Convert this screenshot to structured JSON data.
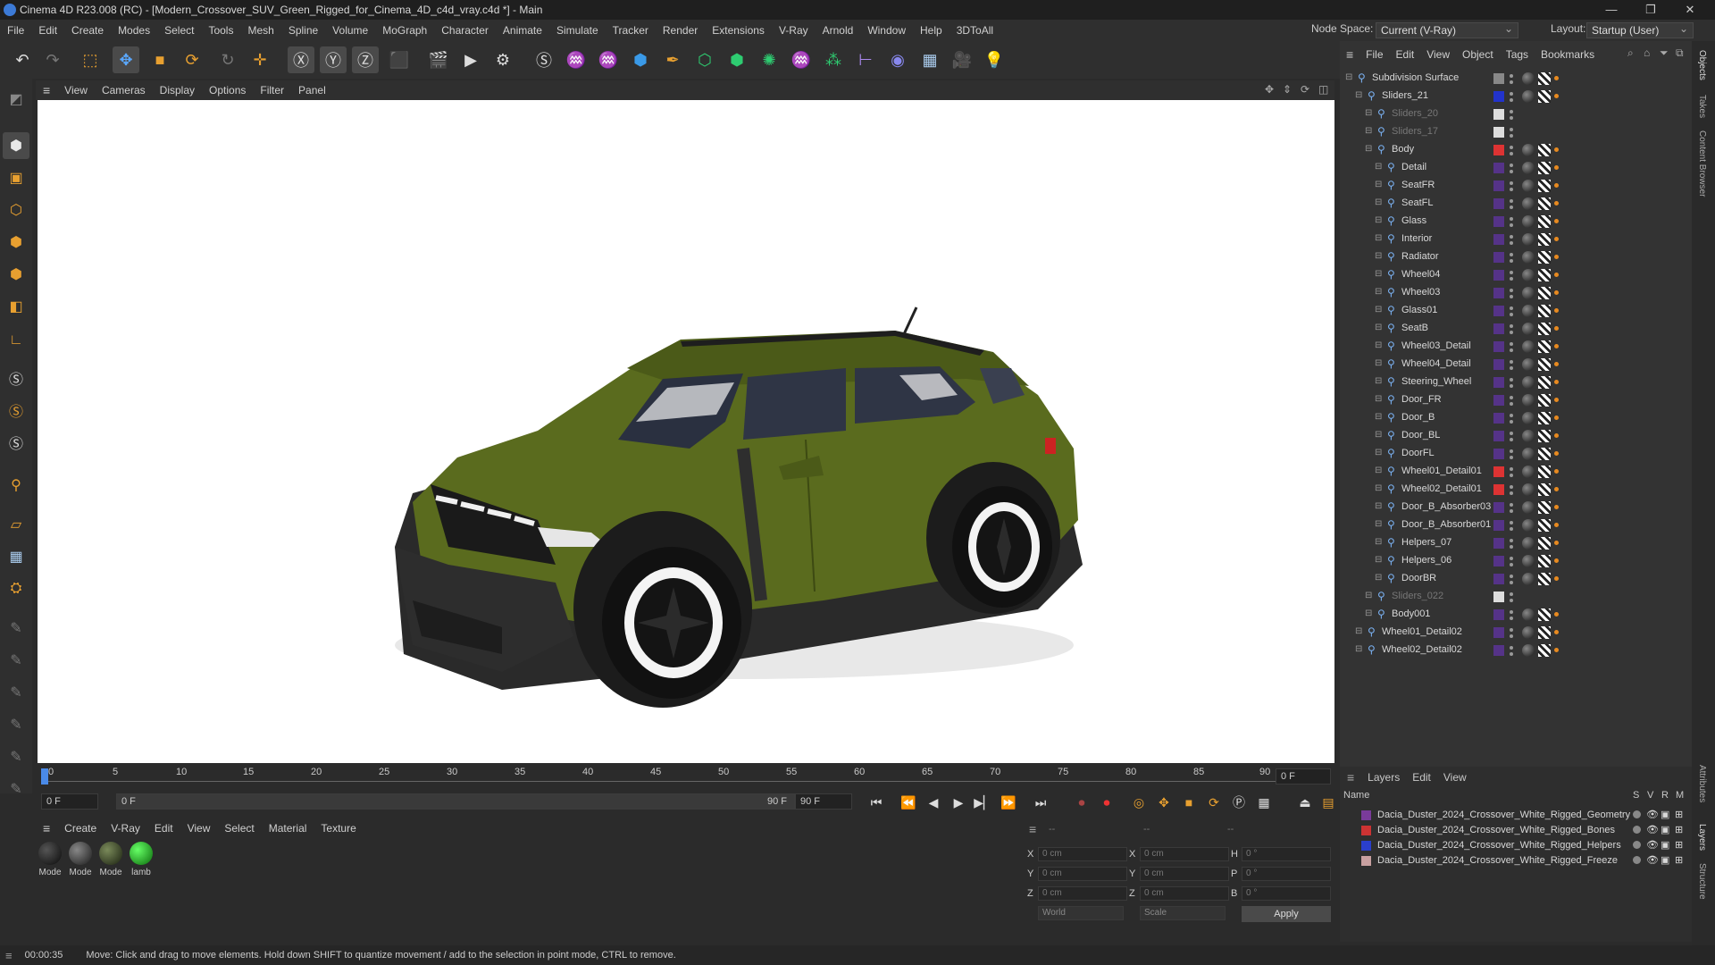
{
  "window": {
    "title": "Cinema 4D R23.008 (RC) - [Modern_Crossover_SUV_Green_Rigged_for_Cinema_4D_c4d_vray.c4d *] - Main",
    "minimize": "—",
    "maximize": "❐",
    "close": "✕"
  },
  "menubar": [
    "File",
    "Edit",
    "Create",
    "Modes",
    "Select",
    "Tools",
    "Mesh",
    "Spline",
    "Volume",
    "MoGraph",
    "Character",
    "Animate",
    "Simulate",
    "Tracker",
    "Render",
    "Extensions",
    "V-Ray",
    "Arnold",
    "Window",
    "Help",
    "3DToAll"
  ],
  "nodespace": {
    "label": "Node Space:",
    "value": "Current (V-Ray)"
  },
  "layout": {
    "label": "Layout:",
    "value": "Startup (User)"
  },
  "viewport_menu": [
    "View",
    "Cameras",
    "Display",
    "Options",
    "Filter",
    "Panel"
  ],
  "timeline": {
    "ticks": [
      "0",
      "5",
      "10",
      "15",
      "20",
      "25",
      "30",
      "35",
      "40",
      "45",
      "50",
      "55",
      "60",
      "65",
      "70",
      "75",
      "80",
      "85",
      "90"
    ],
    "current_frame": "0 F"
  },
  "time_controls": {
    "start": "0 F",
    "current": "0 F",
    "end_range": "90 F",
    "end": "90 F"
  },
  "material_menu": [
    "Create",
    "V-Ray",
    "Edit",
    "View",
    "Select",
    "Material",
    "Texture"
  ],
  "materials": [
    {
      "label": "Mode",
      "color": "#1a1a1a"
    },
    {
      "label": "Mode",
      "color": "#2e2e2e"
    },
    {
      "label": "Mode",
      "color": "#3a4a2a"
    },
    {
      "label": "lamb",
      "color": "#22bb22"
    }
  ],
  "coords": {
    "header_a": "--",
    "header_b": "--",
    "header_c": "--",
    "rows": [
      {
        "l1": "X",
        "v1": "0 cm",
        "l2": "X",
        "v2": "0 cm",
        "l3": "H",
        "v3": "0 °"
      },
      {
        "l1": "Y",
        "v1": "0 cm",
        "l2": "Y",
        "v2": "0 cm",
        "l3": "P",
        "v3": "0 °"
      },
      {
        "l1": "Z",
        "v1": "0 cm",
        "l2": "Z",
        "v2": "0 cm",
        "l3": "B",
        "v3": "0 °"
      }
    ],
    "space": "World",
    "mode": "Scale",
    "apply": "Apply"
  },
  "status": {
    "time": "00:00:35",
    "message": "Move: Click and drag to move elements. Hold down SHIFT to quantize movement / add to the selection in point mode, CTRL to remove."
  },
  "object_menu": [
    "File",
    "Edit",
    "View",
    "Object",
    "Tags",
    "Bookmarks"
  ],
  "objects": [
    {
      "name": "Subdivision Surface",
      "indent": 0,
      "color": "#888888",
      "dim": false
    },
    {
      "name": "Sliders_21",
      "indent": 1,
      "color": "#2233cc",
      "dim": false
    },
    {
      "name": "Sliders_20",
      "indent": 2,
      "color": "#dddddd",
      "dim": true
    },
    {
      "name": "Sliders_17",
      "indent": 2,
      "color": "#dddddd",
      "dim": true
    },
    {
      "name": "Body",
      "indent": 2,
      "color": "#dd3333",
      "dim": false
    },
    {
      "name": "Detail",
      "indent": 3,
      "color": "#553388",
      "dim": false
    },
    {
      "name": "SeatFR",
      "indent": 3,
      "color": "#553388",
      "dim": false
    },
    {
      "name": "SeatFL",
      "indent": 3,
      "color": "#553388",
      "dim": false
    },
    {
      "name": "Glass",
      "indent": 3,
      "color": "#553388",
      "dim": false
    },
    {
      "name": "Interior",
      "indent": 3,
      "color": "#553388",
      "dim": false
    },
    {
      "name": "Radiator",
      "indent": 3,
      "color": "#553388",
      "dim": false
    },
    {
      "name": "Wheel04",
      "indent": 3,
      "color": "#553388",
      "dim": false
    },
    {
      "name": "Wheel03",
      "indent": 3,
      "color": "#553388",
      "dim": false
    },
    {
      "name": "Glass01",
      "indent": 3,
      "color": "#553388",
      "dim": false
    },
    {
      "name": "SeatB",
      "indent": 3,
      "color": "#553388",
      "dim": false
    },
    {
      "name": "Wheel03_Detail",
      "indent": 3,
      "color": "#553388",
      "dim": false
    },
    {
      "name": "Wheel04_Detail",
      "indent": 3,
      "color": "#553388",
      "dim": false
    },
    {
      "name": "Steering_Wheel",
      "indent": 3,
      "color": "#553388",
      "dim": false
    },
    {
      "name": "Door_FR",
      "indent": 3,
      "color": "#553388",
      "dim": false
    },
    {
      "name": "Door_B",
      "indent": 3,
      "color": "#553388",
      "dim": false
    },
    {
      "name": "Door_BL",
      "indent": 3,
      "color": "#553388",
      "dim": false
    },
    {
      "name": "DoorFL",
      "indent": 3,
      "color": "#553388",
      "dim": false
    },
    {
      "name": "Wheel01_Detail01",
      "indent": 3,
      "color": "#dd3333",
      "dim": false
    },
    {
      "name": "Wheel02_Detail01",
      "indent": 3,
      "color": "#dd3333",
      "dim": false
    },
    {
      "name": "Door_B_Absorber03",
      "indent": 3,
      "color": "#553388",
      "dim": false
    },
    {
      "name": "Door_B_Absorber01",
      "indent": 3,
      "color": "#553388",
      "dim": false
    },
    {
      "name": "Helpers_07",
      "indent": 3,
      "color": "#553388",
      "dim": false
    },
    {
      "name": "Helpers_06",
      "indent": 3,
      "color": "#553388",
      "dim": false
    },
    {
      "name": "DoorBR",
      "indent": 3,
      "color": "#553388",
      "dim": false
    },
    {
      "name": "Sliders_022",
      "indent": 2,
      "color": "#dddddd",
      "dim": true
    },
    {
      "name": "Body001",
      "indent": 2,
      "color": "#553388",
      "dim": false
    },
    {
      "name": "Wheel01_Detail02",
      "indent": 1,
      "color": "#553388",
      "dim": false
    },
    {
      "name": "Wheel02_Detail02",
      "indent": 1,
      "color": "#553388",
      "dim": false
    }
  ],
  "layers_menu": [
    "Layers",
    "Edit",
    "View"
  ],
  "layers_header": {
    "name": "Name",
    "s": "S",
    "v": "V",
    "r": "R",
    "m": "M"
  },
  "layers": [
    {
      "name": "Dacia_Duster_2024_Crossover_White_Rigged_Geometry",
      "color": "#7a3b9a"
    },
    {
      "name": "Dacia_Duster_2024_Crossover_White_Rigged_Bones",
      "color": "#cc3333"
    },
    {
      "name": "Dacia_Duster_2024_Crossover_White_Rigged_Helpers",
      "color": "#2a3fcc"
    },
    {
      "name": "Dacia_Duster_2024_Crossover_White_Rigged_Freeze",
      "color": "#c8a0a0"
    }
  ],
  "right_tabs": [
    "Objects",
    "Takes",
    "Content Browser",
    "Attributes",
    "Layers",
    "Structure"
  ]
}
